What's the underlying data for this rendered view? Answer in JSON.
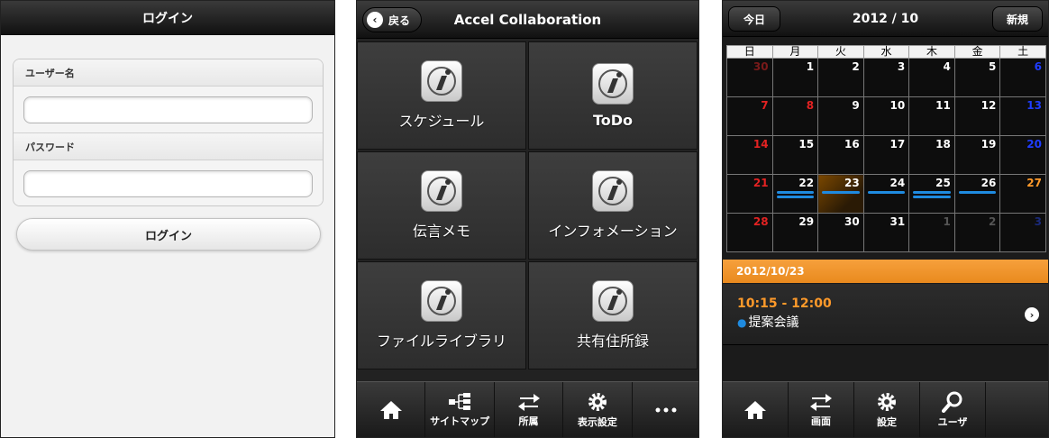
{
  "login_panel": {
    "title": "ログイン",
    "username_label": "ユーザー名",
    "username_value": "",
    "password_label": "パスワード",
    "password_value": "",
    "login_button": "ログイン"
  },
  "menu_panel": {
    "back_label": "戻る",
    "title": "Accel Collaboration",
    "tiles": [
      {
        "label": "スケジュール"
      },
      {
        "label": "ToDo"
      },
      {
        "label": "伝言メモ"
      },
      {
        "label": "インフォメーション"
      },
      {
        "label": "ファイルライブラリ"
      },
      {
        "label": "共有住所録"
      }
    ],
    "footer": [
      {
        "label": "",
        "icon": "home-icon"
      },
      {
        "label": "サイトマップ",
        "icon": "sitemap-icon"
      },
      {
        "label": "所属",
        "icon": "swap-arrows-icon"
      },
      {
        "label": "表示設定",
        "icon": "gear-icon"
      },
      {
        "label": "",
        "icon": "more-dots-icon"
      }
    ]
  },
  "calendar_panel": {
    "today_button": "今日",
    "month_title": "2012 / 10",
    "new_button": "新規",
    "weekdays": [
      "日",
      "月",
      "火",
      "水",
      "木",
      "金",
      "土"
    ],
    "weeks": [
      [
        "30",
        "1",
        "2",
        "3",
        "4",
        "5",
        "6"
      ],
      [
        "7",
        "8",
        "9",
        "10",
        "11",
        "12",
        "13"
      ],
      [
        "14",
        "15",
        "16",
        "17",
        "18",
        "19",
        "20"
      ],
      [
        "21",
        "22",
        "23",
        "24",
        "25",
        "26",
        "27"
      ],
      [
        "28",
        "29",
        "30",
        "31",
        "1",
        "2",
        "3"
      ]
    ],
    "selected_date": "2012/10/23",
    "event_time": "10:15 - 12:00",
    "event_title": "提案会議",
    "footer": [
      {
        "label": "",
        "icon": "home-icon"
      },
      {
        "label": "画面",
        "icon": "swap-arrows-icon"
      },
      {
        "label": "設定",
        "icon": "gear-icon"
      },
      {
        "label": "ユーザ",
        "icon": "search-icon"
      }
    ],
    "colors": {
      "sunday": "#e32222",
      "saturday": "#1f3dff",
      "today_accent": "#ff9a2a",
      "event_bar": "#1f8be0"
    }
  }
}
